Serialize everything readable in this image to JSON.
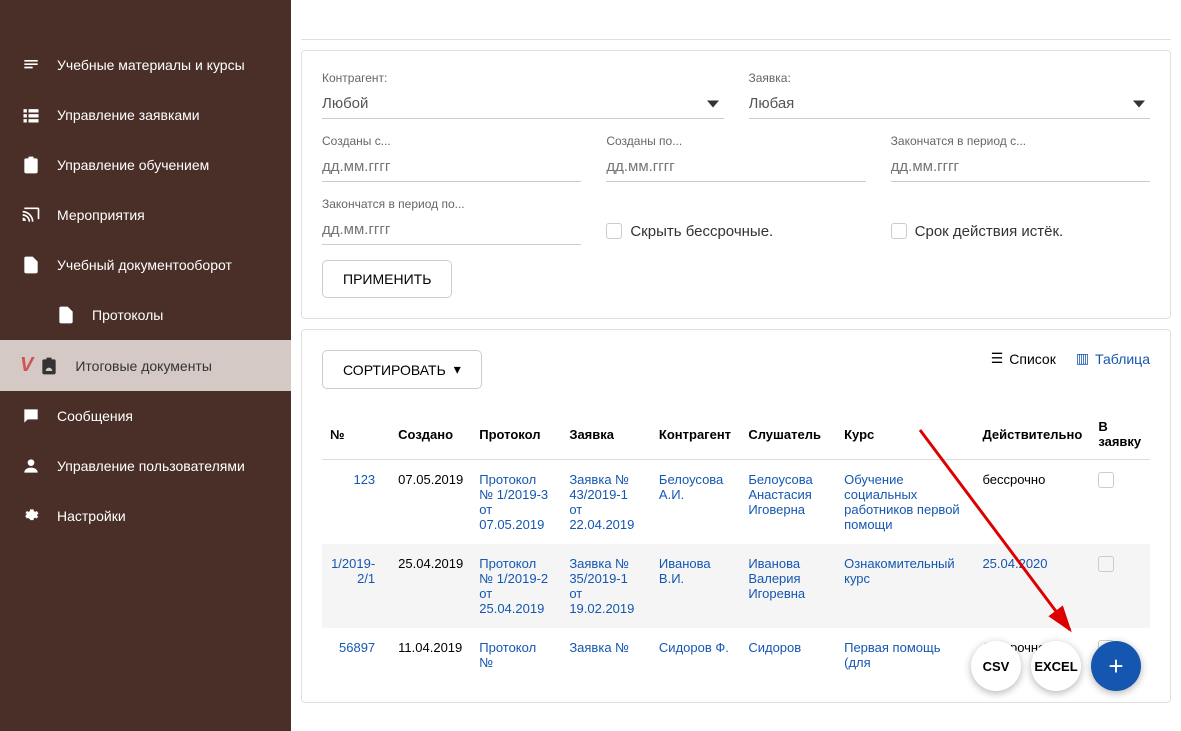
{
  "sidebar": {
    "items": [
      {
        "label": "Учебные материалы и курсы",
        "icon": "book"
      },
      {
        "label": "Управление заявками",
        "icon": "list"
      },
      {
        "label": "Управление обучением",
        "icon": "clipboard"
      },
      {
        "label": "Мероприятия",
        "icon": "cast"
      },
      {
        "label": "Учебный документооборот",
        "icon": "file"
      },
      {
        "label": "Протоколы",
        "icon": "file",
        "sub": true
      },
      {
        "label": "Итоговые документы",
        "icon": "clipboard-user",
        "active": true
      },
      {
        "label": "Сообщения",
        "icon": "message"
      },
      {
        "label": "Управление пользователями",
        "icon": "user"
      },
      {
        "label": "Настройки",
        "icon": "gear"
      }
    ]
  },
  "filters": {
    "contractor_label": "Контрагент:",
    "contractor_value": "Любой",
    "request_label": "Заявка:",
    "request_value": "Любая",
    "created_from_label": "Созданы с...",
    "created_to_label": "Созданы по...",
    "end_from_label": "Закончатся в период с...",
    "end_to_label": "Закончатся в период по...",
    "date_placeholder": "дд.мм.гггг",
    "hide_unlimited": "Скрыть бессрочные.",
    "expired": "Срок действия истёк.",
    "apply_btn": "ПРИМЕНИТЬ"
  },
  "list": {
    "sort_btn": "СОРТИРОВАТЬ",
    "view_list": "Список",
    "view_table": "Таблица",
    "headers": [
      "№",
      "Создано",
      "Протокол",
      "Заявка",
      "Контрагент",
      "Слушатель",
      "Курс",
      "Действительно",
      "В заявку"
    ],
    "rows": [
      {
        "num": "123",
        "created": "07.05.2019",
        "protocol": "Протокол № 1/2019-3 от 07.05.2019",
        "request": "Заявка № 43/2019-1 от 22.04.2019",
        "contractor": "Белоусова А.И.",
        "listener": "Белоусова Анастасия Иговерна",
        "course": "Обучение социальных работников первой помощи",
        "valid": "бессрочно"
      },
      {
        "num": "1/2019-2/1",
        "created": "25.04.2019",
        "protocol": "Протокол № 1/2019-2 от 25.04.2019",
        "request": "Заявка № 35/2019-1 от 19.02.2019",
        "contractor": "Иванова В.И.",
        "listener": "Иванова Валерия Игоревна",
        "course": "Ознакомительный курс",
        "valid": "25.04.2020",
        "valid_link": true
      },
      {
        "num": "56897",
        "created": "11.04.2019",
        "protocol": "Протокол №",
        "request": "Заявка №",
        "contractor": "Сидоров Ф.",
        "listener": "Сидоров",
        "course": "Первая помощь (для",
        "valid": "бессрочно"
      }
    ]
  },
  "fab": {
    "csv": "CSV",
    "excel": "EXCEL",
    "add": "+"
  }
}
